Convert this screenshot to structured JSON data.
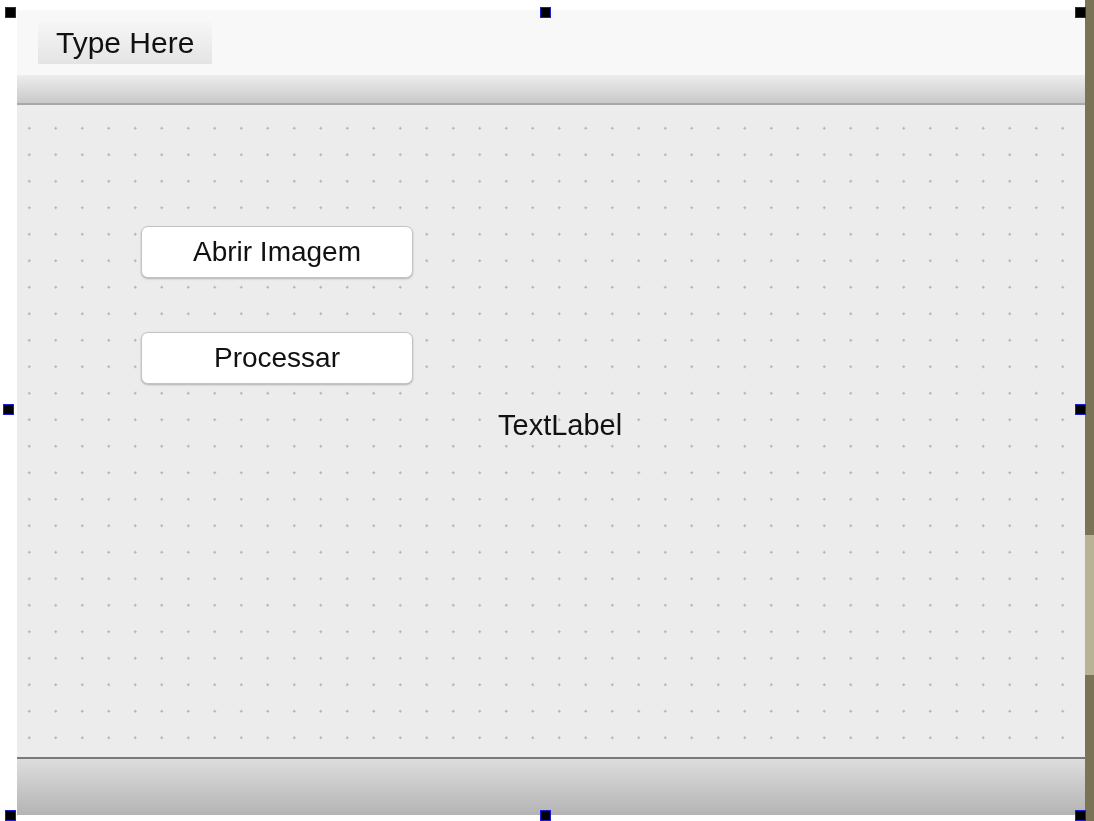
{
  "menu_bar": {
    "items": [
      {
        "label": "Type Here"
      }
    ]
  },
  "form": {
    "widgets": [
      {
        "kind": "button",
        "label": "Abrir Imagem"
      },
      {
        "kind": "button",
        "label": "Processar"
      },
      {
        "kind": "label",
        "label": "TextLabel"
      }
    ]
  }
}
